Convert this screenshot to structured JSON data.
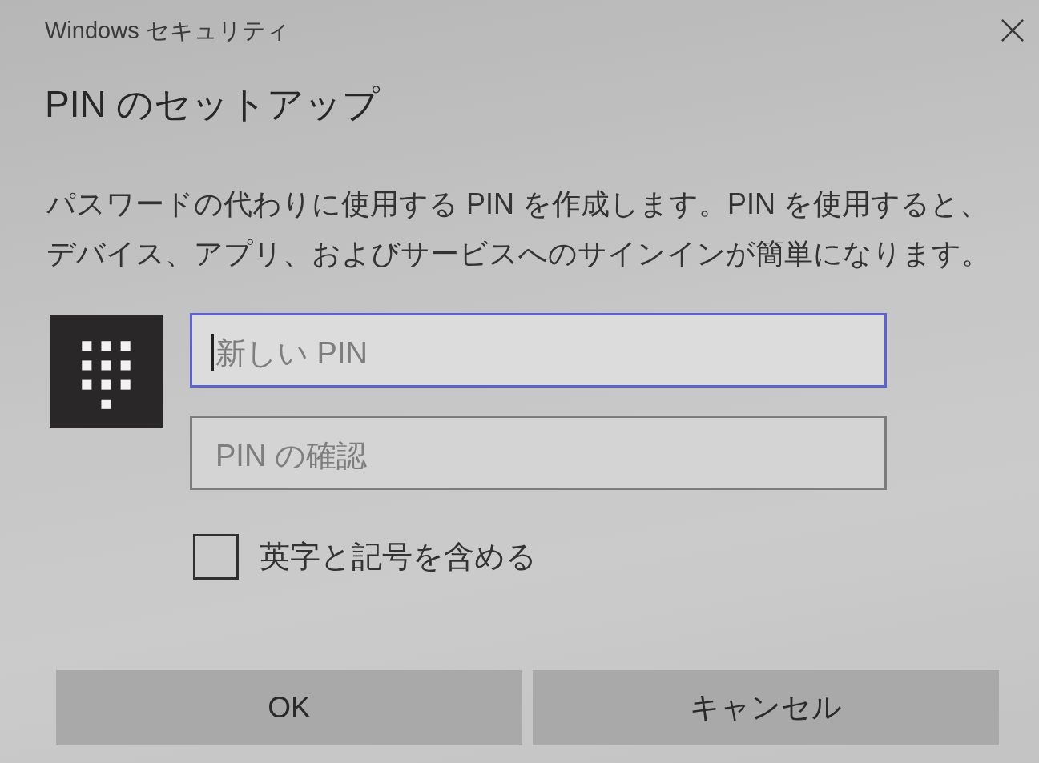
{
  "window": {
    "title": "Windows セキュリティ"
  },
  "heading": "PIN のセットアップ",
  "description": [
    "パスワードの代わりに使用する PIN を作成します。PIN を使用すると、",
    "デバイス、アプリ、およびサービスへのサインインが簡単になります。"
  ],
  "fields": [
    {
      "placeholder": "新しい PIN",
      "focused": true
    },
    {
      "placeholder": "PIN の確認",
      "focused": false
    }
  ],
  "checkbox": {
    "label": "英字と記号を含める",
    "checked": false
  },
  "buttons": [
    {
      "label": "OK"
    },
    {
      "label": "キャンセル"
    }
  ]
}
